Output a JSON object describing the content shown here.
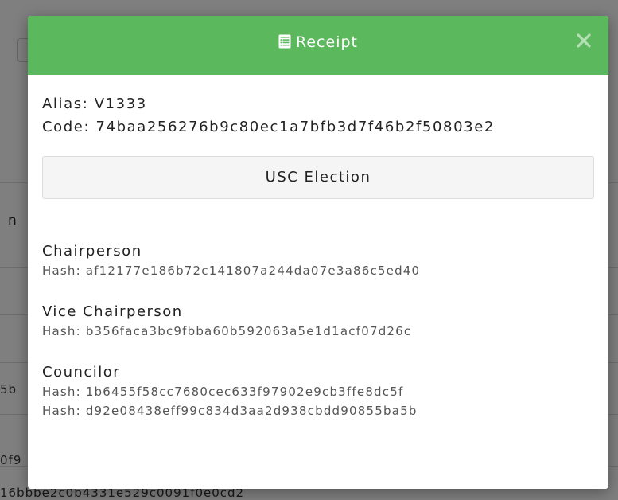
{
  "background": {
    "column_header": "n",
    "rows": [
      "5b",
      "0f9",
      "16bbbe2c0b4331e529c0091f0e0cd2"
    ]
  },
  "modal": {
    "title": "Receipt",
    "header_color": "#5cb85c",
    "title_icon": "list-alt-icon",
    "close_icon": "close-icon",
    "alias": "Alias: V1333",
    "code": "Code: 74baa256276b9c80ec1a7bfb3d7f46b2f50803e2",
    "election_name": "USC Election",
    "positions": [
      {
        "title": "Chairperson",
        "hashes": [
          "Hash: af12177e186b72c141807a244da07e3a86c5ed40"
        ]
      },
      {
        "title": "Vice Chairperson",
        "hashes": [
          "Hash: b356faca3bc9fbba60b592063a5e1d1acf07d26c"
        ]
      },
      {
        "title": "Councilor",
        "hashes": [
          "Hash: 1b6455f58cc7680cec633f97902e9cb3ffe8dc5f",
          "Hash: d92e08438eff99c834d3aa2d938cbdd90855ba5b"
        ]
      }
    ]
  }
}
